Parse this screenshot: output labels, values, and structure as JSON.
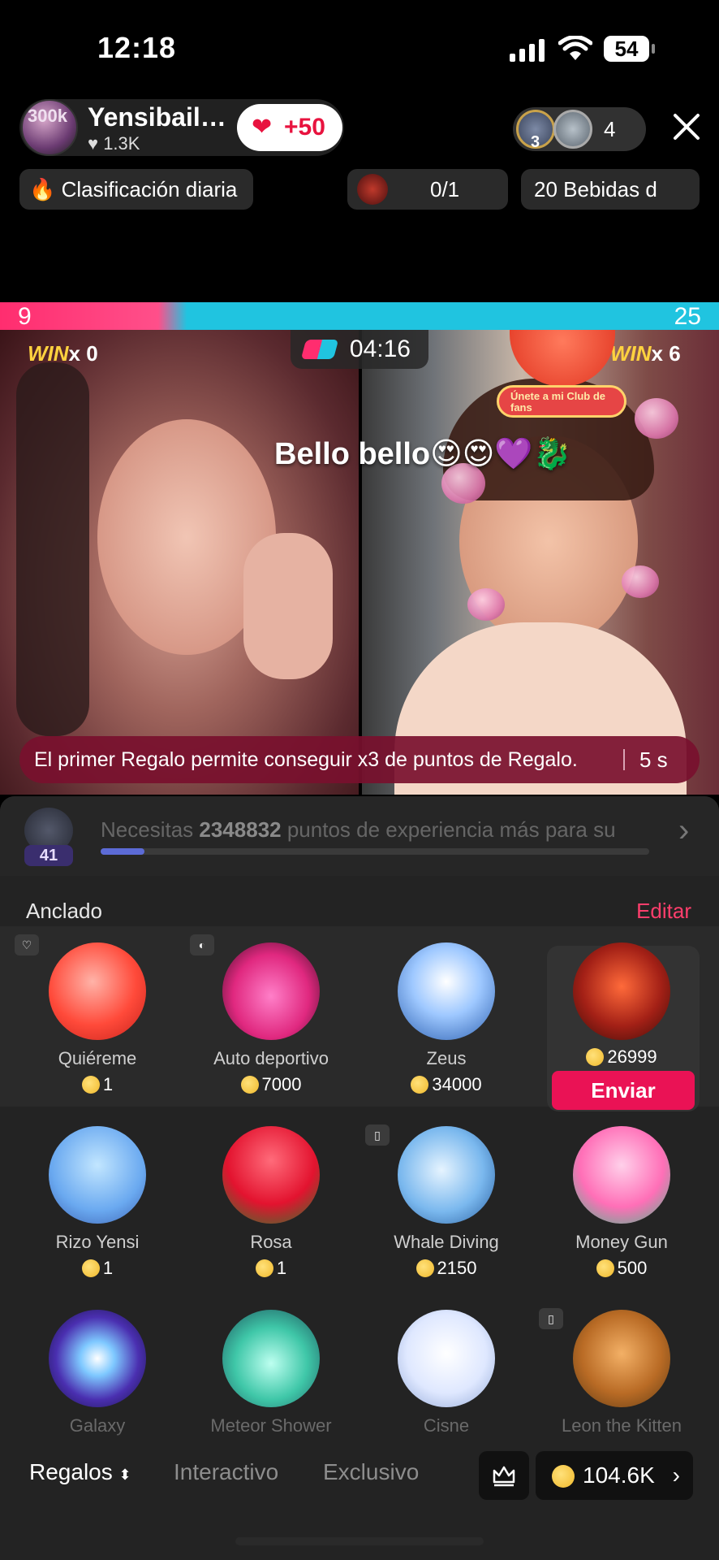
{
  "status_bar": {
    "time": "12:18",
    "battery": "54"
  },
  "host": {
    "avatar_text": "300k",
    "name": "Yensibail…",
    "likes": "1.3K",
    "like_boost": "+50"
  },
  "viewers": {
    "rank": "3",
    "count": "4"
  },
  "pills": {
    "daily_ranking": "Clasificación diaria",
    "goal_progress": "0/1",
    "drinks": "20 Bebidas d"
  },
  "battle": {
    "left_score": "9",
    "right_score": "25",
    "timer": "04:16",
    "left_win_label": "WIN",
    "left_win_count": "x 0",
    "right_win_label": "WIN",
    "right_win_count": "x 6",
    "progress_left_fraction": 0.26,
    "left_color": "#ff2d6f",
    "right_color": "#20c4e0"
  },
  "comment": "Bello bello😍😍💜🐉",
  "fan_club": "Únete a mi Club de fans",
  "banner": {
    "text": "El primer Regalo permite conseguir x3 de puntos de Regalo.",
    "countdown": "5 s"
  },
  "xp": {
    "level": "41",
    "message_prefix": "Necesitas ",
    "points": "2348832",
    "message_suffix": " puntos de experiencia más para su",
    "progress_fraction": 0.08
  },
  "gift_panel": {
    "pinned_title": "Anclado",
    "edit_label": "Editar",
    "send_label": "Enviar",
    "gifts": [
      {
        "name": "Quiéreme",
        "price": "1",
        "icon": "heart-gift-icon"
      },
      {
        "name": "Auto deportivo",
        "price": "7000",
        "icon": "sports-car-icon"
      },
      {
        "name": "Zeus",
        "price": "34000",
        "icon": "zeus-icon"
      },
      {
        "name": "",
        "price": "26999",
        "icon": "dragon-icon"
      },
      {
        "name": "Rizo Yensi",
        "price": "1",
        "icon": "yensi-heart-icon"
      },
      {
        "name": "Rosa",
        "price": "1",
        "icon": "rose-icon"
      },
      {
        "name": "Whale Diving",
        "price": "2150",
        "icon": "whale-icon"
      },
      {
        "name": "Money Gun",
        "price": "500",
        "icon": "money-gun-icon"
      },
      {
        "name": "Galaxy",
        "price": "",
        "icon": "galaxy-icon"
      },
      {
        "name": "Meteor Shower",
        "price": "",
        "icon": "meteor-icon"
      },
      {
        "name": "Cisne",
        "price": "",
        "icon": "swan-icon"
      },
      {
        "name": "Leon the Kitten",
        "price": "",
        "icon": "lion-icon"
      }
    ]
  },
  "tabs": {
    "gifts": "Regalos",
    "interactive": "Interactivo",
    "exclusive": "Exclusivo"
  },
  "wallet": {
    "balance": "104.6K"
  },
  "colors": {
    "accent": "#ea1255",
    "edit": "#ff3e6c",
    "coin": "#f0b82a"
  }
}
